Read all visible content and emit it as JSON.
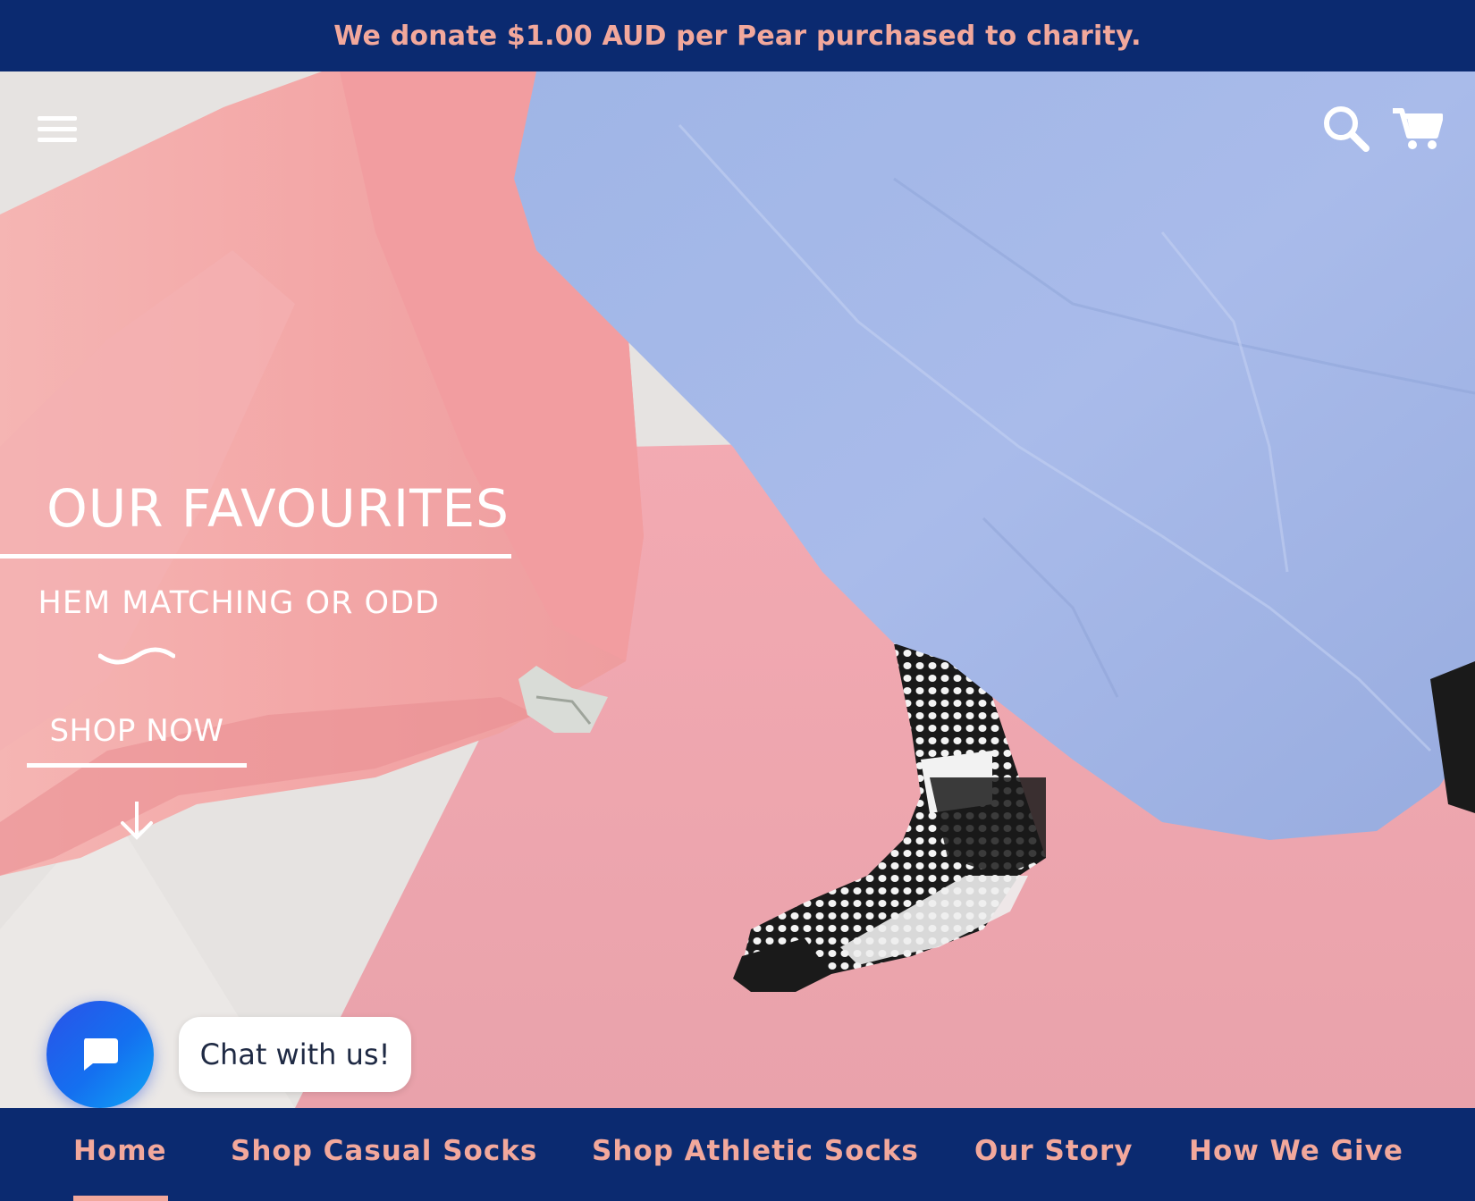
{
  "announcement": {
    "text": "We donate $1.00 AUD per Pear purchased to charity."
  },
  "header": {
    "menu_icon": "hamburger-menu-icon",
    "search_icon": "search-icon",
    "cart_icon": "cart-icon"
  },
  "hero": {
    "title": "OUR FAVOURITES",
    "subtitle": "HEM MATCHING OR ODD",
    "cta_label": "SHOP NOW",
    "scroll_icon": "arrow-down-icon"
  },
  "chat": {
    "label": "Chat with us!",
    "icon": "chat-bubble-icon",
    "color": "#1a6ff0"
  },
  "nav": {
    "items": [
      {
        "label": "Home",
        "active": true
      },
      {
        "label": "Shop Casual Socks"
      },
      {
        "label": "Shop Athletic Socks"
      },
      {
        "label": "Our Story"
      },
      {
        "label": "How We Give"
      }
    ]
  },
  "colors": {
    "brand_navy": "#0b2a70",
    "accent_pink": "#f2a89c",
    "hero_pink": "#f0a7ae",
    "paper_blue": "#a8b8e8"
  }
}
